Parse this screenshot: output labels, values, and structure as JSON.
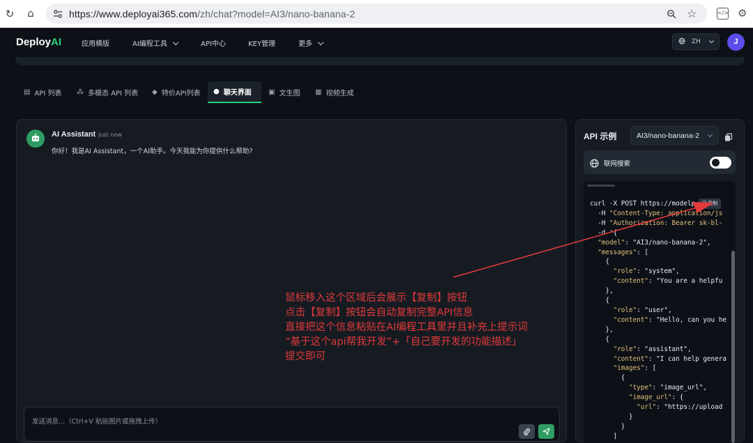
{
  "browser": {
    "url_host": "https://www.deployai365.com",
    "url_path": "/zh/chat?model=AI3/nano-banana-2"
  },
  "navbar": {
    "logo_main": "Deploy",
    "logo_accent": "AI",
    "items": [
      {
        "label": "应用横版"
      },
      {
        "label": "AI编程工具"
      },
      {
        "label": "API中心"
      },
      {
        "label": "KEY管理"
      },
      {
        "label": "更多"
      }
    ],
    "lang": "ZH",
    "avatar": "J"
  },
  "tabs": [
    {
      "label": "API 列表"
    },
    {
      "label": "多模态 API 列表"
    },
    {
      "label": "特价API列表"
    },
    {
      "label": "聊天界面"
    },
    {
      "label": "文生图"
    },
    {
      "label": "视频生成"
    }
  ],
  "chat": {
    "bot_name": "AI Assistant",
    "bot_time": "Just now",
    "bot_message": "你好！我是AI Assistant，一个AI助手。今天我能为你提供什么帮助?",
    "input_placeholder": "发送消息...（Ctrl+V 粘贴图片或拖拽上传）"
  },
  "annotation": "鼠标移入这个区域后会展示【复制】按钮\n点击【复制】按钮会自动复制完整API信息\n直接把这个信息粘贴在AI编程工具里并且补充上提示词\n“基于这个api帮我开发”+「自己要开发的功能描述」\n提交即可",
  "api_panel": {
    "title": "API 示例",
    "model": "AI3/nano-banana-2",
    "web_search_label": "联网搜索",
    "web_search_on": true,
    "copy_label": "复制",
    "code_lines": [
      "curl -X POST https://modelp",
      "  -H \"Content-Type: application/js",
      "  -H \"Authorization: Bearer sk-bl-",
      "  -d '{",
      "  \"model\": \"AI3/nano-banana-2\",",
      "  \"messages\": [",
      "    {",
      "      \"role\": \"system\",",
      "      \"content\": \"You are a helpfu",
      "    },",
      "    {",
      "      \"role\": \"user\",",
      "      \"content\": \"Hello, can you he",
      "    },",
      "    {",
      "      \"role\": \"assistant\",",
      "      \"content\": \"I can help genera",
      "      \"images\": [",
      "        {",
      "          \"type\": \"image_url\",",
      "          \"image_url\": {",
      "            \"url\": \"https://upload",
      "          }",
      "        }",
      "      ]"
    ]
  },
  "colors": {
    "accent_green": "#2bd17e",
    "annotation_red": "#e03a3a",
    "avatar_purple": "#5b4ee8"
  }
}
